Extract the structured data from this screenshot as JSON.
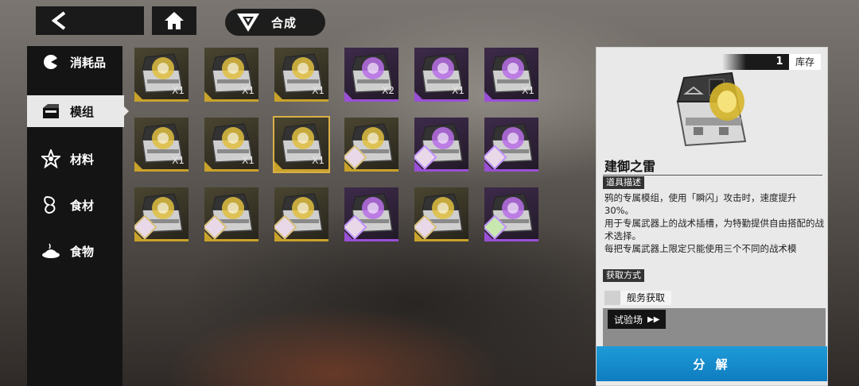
{
  "topbar": {
    "synth_label": "合成"
  },
  "sidebar": {
    "items": [
      {
        "label": "消耗品",
        "icon": "pie-icon",
        "active": false
      },
      {
        "label": "模组",
        "icon": "box-icon",
        "active": true
      },
      {
        "label": "材料",
        "icon": "star-icon",
        "active": false
      },
      {
        "label": "食材",
        "icon": "ingredient-icon",
        "active": false
      },
      {
        "label": "食物",
        "icon": "food-icon",
        "active": false
      }
    ]
  },
  "grid": {
    "items": [
      {
        "rarity": "gold",
        "qty": "X1",
        "portrait": false
      },
      {
        "rarity": "gold",
        "qty": "X1",
        "portrait": false
      },
      {
        "rarity": "gold",
        "qty": "X1",
        "portrait": false
      },
      {
        "rarity": "purple",
        "qty": "X2",
        "portrait": false
      },
      {
        "rarity": "purple",
        "qty": "X1",
        "portrait": false
      },
      {
        "rarity": "purple",
        "qty": "X1",
        "portrait": false
      },
      {
        "rarity": "gold",
        "qty": "X1",
        "portrait": false
      },
      {
        "rarity": "gold",
        "qty": "X1",
        "portrait": false
      },
      {
        "rarity": "gold",
        "qty": "X1",
        "portrait": false,
        "selected": true
      },
      {
        "rarity": "gold",
        "qty": "",
        "portrait": true
      },
      {
        "rarity": "purple",
        "qty": "",
        "portrait": true
      },
      {
        "rarity": "purple",
        "qty": "",
        "portrait": true
      },
      {
        "rarity": "gold",
        "qty": "",
        "portrait": true
      },
      {
        "rarity": "gold",
        "qty": "",
        "portrait": true
      },
      {
        "rarity": "gold",
        "qty": "",
        "portrait": true
      },
      {
        "rarity": "purple",
        "qty": "",
        "portrait": true
      },
      {
        "rarity": "gold",
        "qty": "",
        "portrait": true
      },
      {
        "rarity": "purple",
        "qty": "",
        "portrait": true
      }
    ]
  },
  "detail": {
    "stock_count": "1",
    "stock_label": "库存",
    "name": "建御之雷",
    "desc_label": "道具描述",
    "desc_lines": [
      "鸦的专属模组，使用「瞬闪」攻击时，速度提升30%。",
      "用于专属武器上的战术插槽，为特勤提供自由搭配的战术选择。",
      "每把专属武器上限定只能使用三个不同的战术模"
    ],
    "source_label": "获取方式",
    "source_text": "舰务获取",
    "trial_label": "试验场",
    "decompose_label": "分 解"
  },
  "colors": {
    "gold": "#c9a22a",
    "purple": "#9b4fd6",
    "accent_blue": "#1e9bd8"
  }
}
